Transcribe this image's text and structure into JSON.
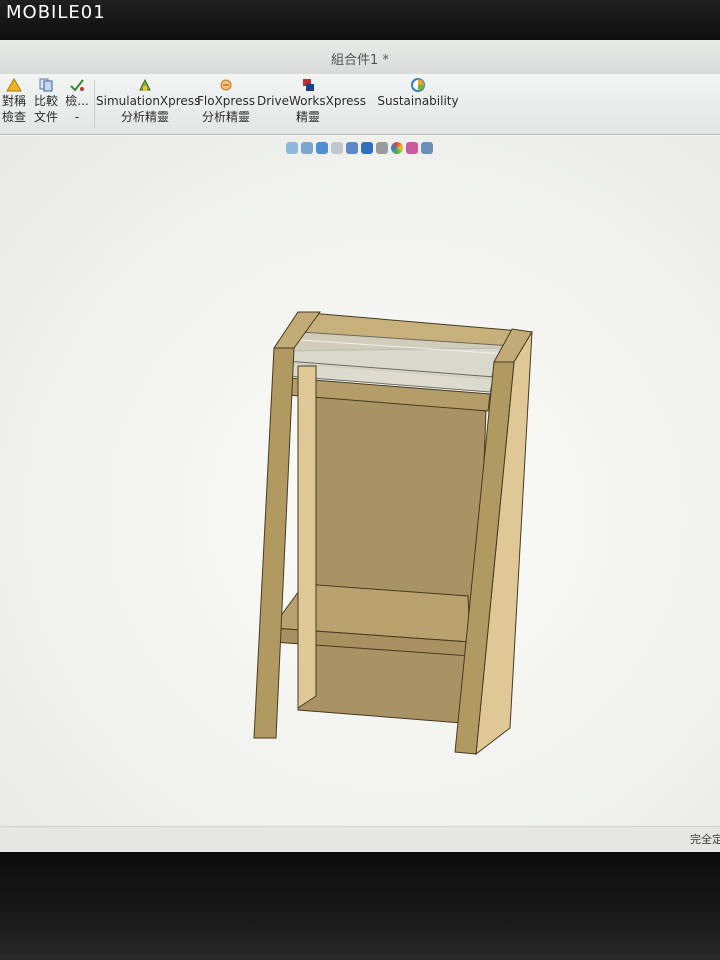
{
  "watermark": "MOBILE01",
  "window": {
    "title": "組合件1 *"
  },
  "ribbon": {
    "symmetry": {
      "line1": "對稱",
      "line2": "檢查"
    },
    "compare": {
      "line1": "比較",
      "line2": "文件"
    },
    "check": {
      "line1": "檢...",
      "line2": "-"
    },
    "simulation": {
      "line1": "SimulationXpress",
      "line2": "分析精靈"
    },
    "flo": {
      "line1": "FloXpress",
      "line2": "分析精靈"
    },
    "driveworks": {
      "line1": "DriveWorksXpress",
      "line2": "精靈"
    },
    "sustainability": {
      "line1": "Sustainability"
    }
  },
  "heads_up_toolbar": [
    "zoom-to-fit-icon",
    "zoom-to-area-icon",
    "previous-view-icon",
    "section-view-icon",
    "view-orientation-icon",
    "display-style-icon",
    "hide-show-icon",
    "edit-appearance-icon",
    "apply-scene-icon",
    "view-settings-icon"
  ],
  "status": {
    "right": "完全定義"
  },
  "colors": {
    "wood_front": "#b09a62",
    "wood_inner": "#a99263",
    "wood_light": "#dfc896",
    "wood_edge": "#463a22",
    "glass": "#d2d2c6"
  }
}
